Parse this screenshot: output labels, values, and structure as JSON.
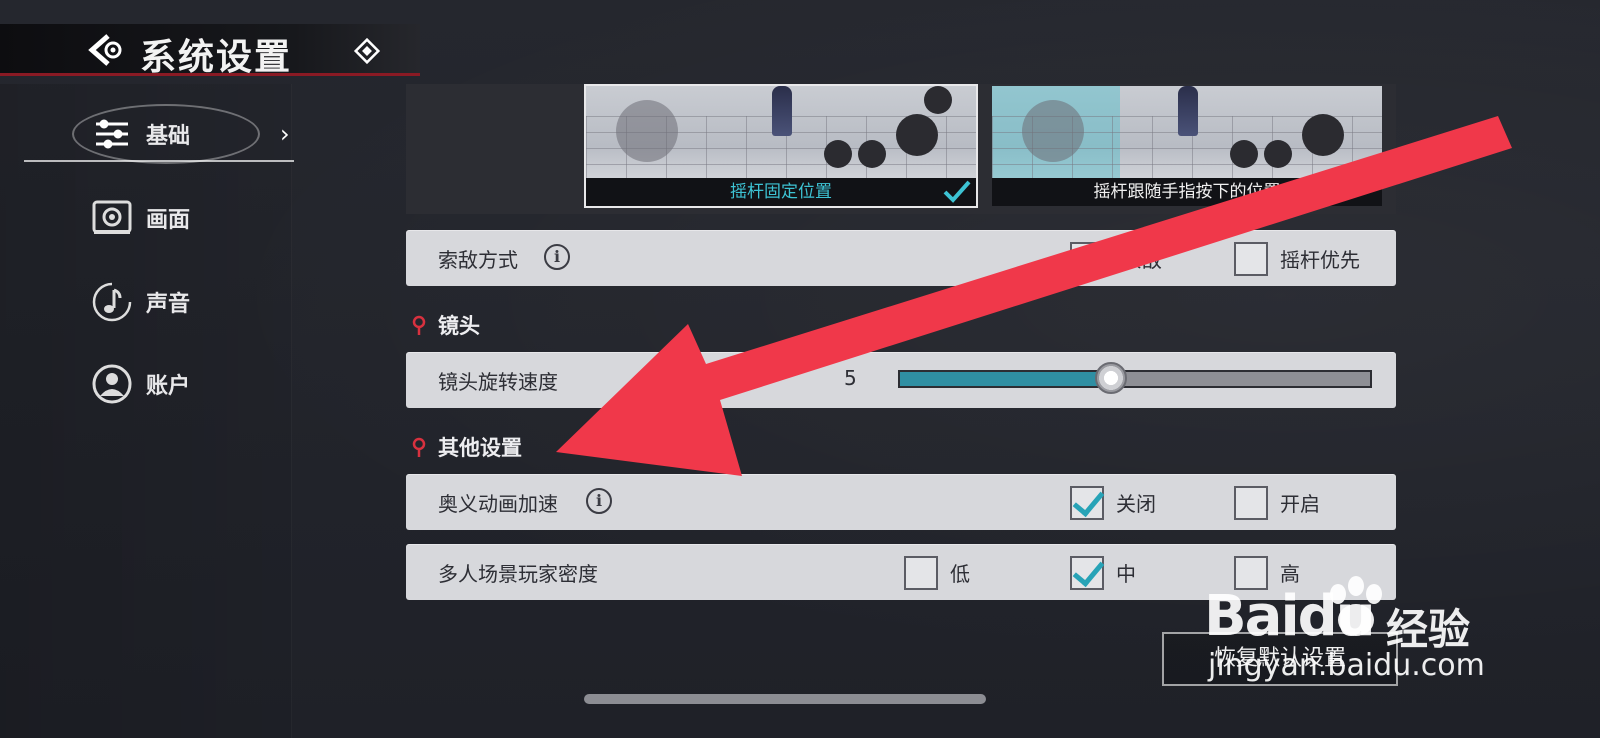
{
  "header": {
    "title": "系统设置"
  },
  "sidebar": {
    "items": [
      {
        "label": "基础",
        "icon": "sliders-icon"
      },
      {
        "label": "画面",
        "icon": "display-icon"
      },
      {
        "label": "声音",
        "icon": "music-note-icon"
      },
      {
        "label": "账户",
        "icon": "user-icon"
      }
    ],
    "active": "基础"
  },
  "joystick": {
    "options": [
      {
        "caption": "摇杆固定位置",
        "selected": true
      },
      {
        "caption": "摇杆跟随手指按下的位置",
        "selected": false
      }
    ]
  },
  "targeting": {
    "label": "索敌方式",
    "options": [
      {
        "label": "索敌",
        "checked": true
      },
      {
        "label": "摇杆优先",
        "checked": false
      }
    ]
  },
  "camera": {
    "section_title": "镜头",
    "rotation_label": "镜头旋转速度",
    "rotation_value": "5",
    "rotation_fraction": 0.45
  },
  "other": {
    "section_title": "其他设置",
    "ultimate": {
      "label": "奥义动画加速",
      "options": [
        {
          "label": "关闭",
          "checked": true
        },
        {
          "label": "开启",
          "checked": false
        }
      ]
    },
    "density": {
      "label": "多人场景玩家密度",
      "options": [
        {
          "label": "低",
          "checked": false
        },
        {
          "label": "中",
          "checked": true
        },
        {
          "label": "高",
          "checked": false
        }
      ]
    }
  },
  "reset_button": "恢复默认设置",
  "watermark": {
    "brand": "Baidu",
    "cn": "经验",
    "url": "jingyan.baidu.com"
  },
  "colors": {
    "accent": "#27a3b7",
    "arrow": "#f0384a",
    "header_line": "#8a1a24"
  }
}
